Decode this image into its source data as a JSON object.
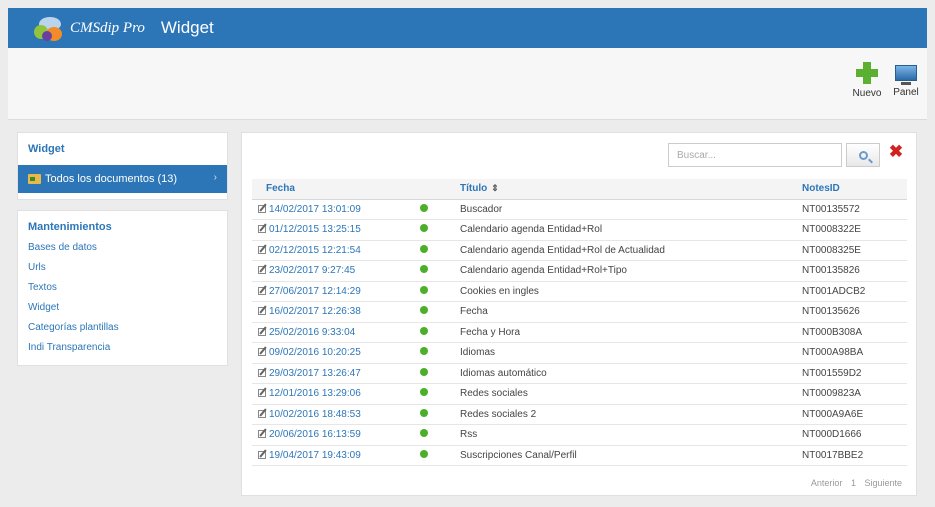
{
  "header": {
    "brand": "CMSdip Pro",
    "title": "Widget"
  },
  "toolbar": {
    "new_label": "Nuevo",
    "panel_label": "Panel"
  },
  "sidebar": {
    "section_title": "Widget",
    "active_item": "Todos los documentos (13)",
    "maintenance_title": "Mantenimientos",
    "maintenance_items": [
      "Bases de datos",
      "Urls",
      "Textos",
      "Widget",
      "Categorías plantillas",
      "Indi Transparencia"
    ]
  },
  "search": {
    "placeholder": "Buscar..."
  },
  "table": {
    "headers": {
      "fecha": "Fecha",
      "titulo": "Título",
      "notesid": "NotesID"
    },
    "rows": [
      {
        "fecha": "14/02/2017 13:01:09",
        "titulo": "Buscador",
        "notesid": "NT00135572"
      },
      {
        "fecha": "01/12/2015 13:25:15",
        "titulo": "Calendario agenda Entidad+Rol",
        "notesid": "NT0008322E"
      },
      {
        "fecha": "02/12/2015 12:21:54",
        "titulo": "Calendario agenda Entidad+Rol de Actualidad",
        "notesid": "NT0008325E"
      },
      {
        "fecha": "23/02/2017 9:27:45",
        "titulo": "Calendario agenda Entidad+Rol+Tipo",
        "notesid": "NT00135826"
      },
      {
        "fecha": "27/06/2017 12:14:29",
        "titulo": "Cookies en ingles",
        "notesid": "NT001ADCB2"
      },
      {
        "fecha": "16/02/2017 12:26:38",
        "titulo": "Fecha",
        "notesid": "NT00135626"
      },
      {
        "fecha": "25/02/2016 9:33:04",
        "titulo": "Fecha y Hora",
        "notesid": "NT000B308A"
      },
      {
        "fecha": "09/02/2016 10:20:25",
        "titulo": "Idiomas",
        "notesid": "NT000A98BA"
      },
      {
        "fecha": "29/03/2017 13:26:47",
        "titulo": "Idiomas automático",
        "notesid": "NT001559D2"
      },
      {
        "fecha": "12/01/2016 13:29:06",
        "titulo": "Redes sociales",
        "notesid": "NT0009823A"
      },
      {
        "fecha": "10/02/2016 18:48:53",
        "titulo": "Redes sociales 2",
        "notesid": "NT000A9A6E"
      },
      {
        "fecha": "20/06/2016 16:13:59",
        "titulo": "Rss",
        "notesid": "NT000D1666"
      },
      {
        "fecha": "19/04/2017 19:43:09",
        "titulo": "Suscripciones Canal/Perfil",
        "notesid": "NT0017BBE2"
      }
    ]
  },
  "pagination": {
    "prev": "Anterior",
    "page": "1",
    "next": "Siguiente"
  },
  "colors": {
    "accent": "#2c76b8",
    "status_ok": "#4caf2a",
    "clear": "#d0231f"
  }
}
